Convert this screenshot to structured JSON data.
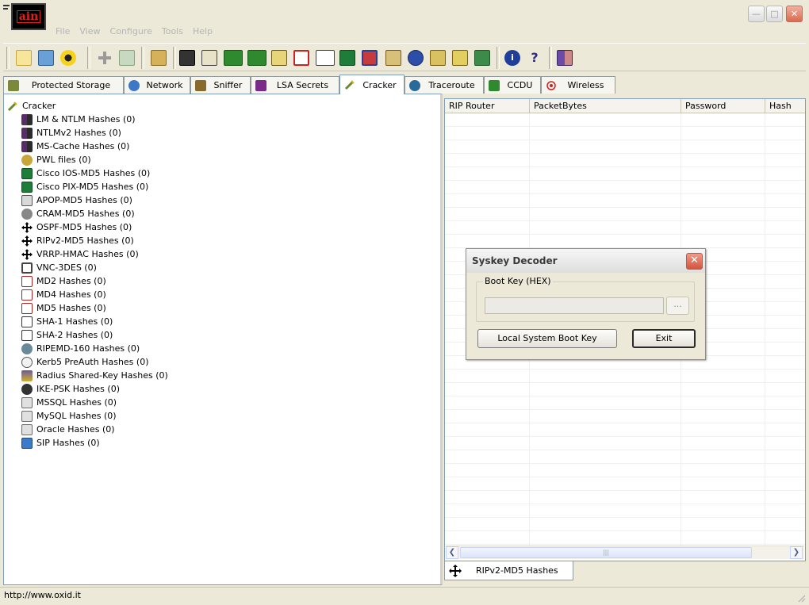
{
  "window": {
    "app_logo_text": "ain"
  },
  "menu": [
    "File",
    "View",
    "Configure",
    "Tools",
    "Help"
  ],
  "toolbar": {
    "buttons": [
      "open",
      "save",
      "radiation",
      "add",
      "rescan",
      "delete",
      "route",
      "traceroute",
      "ntlm",
      "lm",
      "scan",
      "decoder",
      "password",
      "cisco",
      "vnc",
      "lsa",
      "wireless",
      "folder",
      "db",
      "display",
      "crypto",
      "info",
      "help",
      "exit"
    ]
  },
  "tabs": [
    {
      "label": "Protected Storage",
      "icon": "storage-icon"
    },
    {
      "label": "Network",
      "icon": "network-icon"
    },
    {
      "label": "Sniffer",
      "icon": "sniffer-icon"
    },
    {
      "label": "LSA Secrets",
      "icon": "lsa-icon"
    },
    {
      "label": "Cracker",
      "icon": "cracker-icon"
    },
    {
      "label": "Traceroute",
      "icon": "traceroute-icon"
    },
    {
      "label": "CCDU",
      "icon": "ccdu-icon"
    },
    {
      "label": "Wireless",
      "icon": "wireless-icon"
    }
  ],
  "tree": {
    "root": "Cracker",
    "items": [
      {
        "label": "LM & NTLM Hashes (0)",
        "icon": "users-icon"
      },
      {
        "label": "NTLMv2 Hashes (0)",
        "icon": "users-icon"
      },
      {
        "label": "MS-Cache Hashes (0)",
        "icon": "users-icon"
      },
      {
        "label": "PWL files (0)",
        "icon": "key-icon"
      },
      {
        "label": "Cisco IOS-MD5 Hashes (0)",
        "icon": "cisco-icon"
      },
      {
        "label": "Cisco PIX-MD5 Hashes (0)",
        "icon": "cisco-icon"
      },
      {
        "label": "APOP-MD5 Hashes (0)",
        "icon": "mail-icon"
      },
      {
        "label": "CRAM-MD5 Hashes (0)",
        "icon": "globe-icon"
      },
      {
        "label": "OSPF-MD5 Hashes (0)",
        "icon": "arrows-icon"
      },
      {
        "label": "RIPv2-MD5 Hashes (0)",
        "icon": "arrows-icon"
      },
      {
        "label": "VRRP-HMAC Hashes (0)",
        "icon": "arrows-icon"
      },
      {
        "label": "VNC-3DES (0)",
        "icon": "vnc-icon"
      },
      {
        "label": "MD2 Hashes (0)",
        "icon": "md-icon"
      },
      {
        "label": "MD4 Hashes (0)",
        "icon": "md-icon"
      },
      {
        "label": "MD5 Hashes (0)",
        "icon": "md-icon"
      },
      {
        "label": "SHA-1 Hashes (0)",
        "icon": "sha-icon"
      },
      {
        "label": "SHA-2 Hashes (0)",
        "icon": "sha-icon"
      },
      {
        "label": "RIPEMD-160 Hashes (0)",
        "icon": "ripemd-icon"
      },
      {
        "label": "Kerb5 PreAuth Hashes (0)",
        "icon": "kerberos-icon"
      },
      {
        "label": "Radius Shared-Key Hashes (0)",
        "icon": "radius-icon"
      },
      {
        "label": "IKE-PSK Hashes (0)",
        "icon": "ike-icon"
      },
      {
        "label": "MSSQL Hashes (0)",
        "icon": "database-icon"
      },
      {
        "label": "MySQL Hashes (0)",
        "icon": "database-icon"
      },
      {
        "label": "Oracle Hashes (0)",
        "icon": "database-icon"
      },
      {
        "label": "SIP Hashes (0)",
        "icon": "sip-icon"
      }
    ]
  },
  "list": {
    "columns": [
      "RIP Router",
      "PacketBytes",
      "Password",
      "Hash"
    ]
  },
  "bottom_tab": {
    "label": "RIPv2-MD5 Hashes"
  },
  "dialog": {
    "title": "Syskey Decoder",
    "group_label": "Boot Key (HEX)",
    "boot_key_value": "",
    "browse_label": "...",
    "local_button": "Local System Boot Key",
    "exit_button": "Exit"
  },
  "status": {
    "url": "http://www.oxid.it"
  },
  "colors": {
    "window_bg": "#ece9d8",
    "tab_border": "#919b9c",
    "selection_border": "#7f9db9"
  }
}
